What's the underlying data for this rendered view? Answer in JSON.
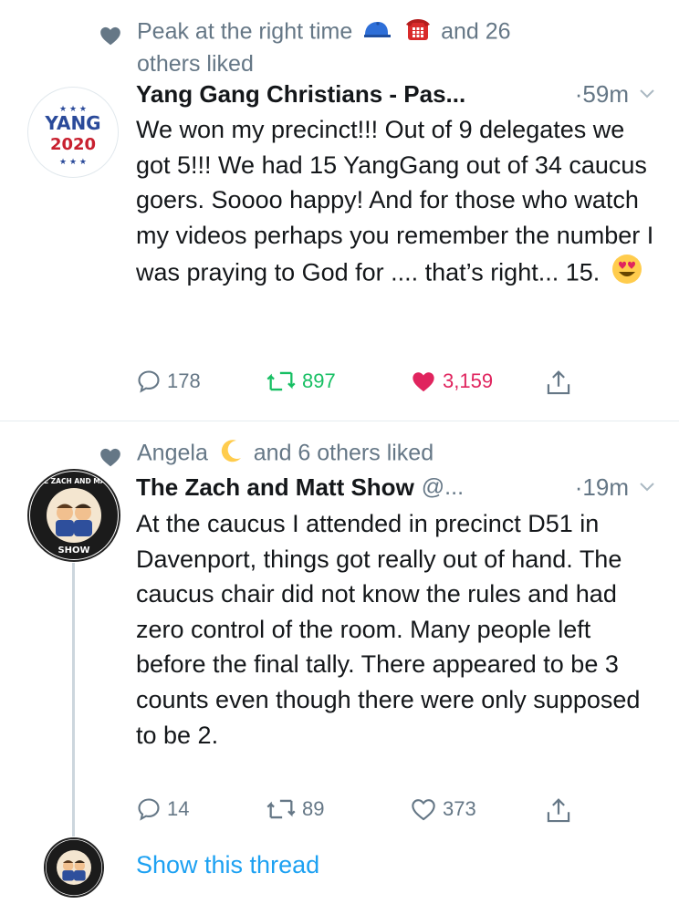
{
  "colors": {
    "accent": "#1da1f2",
    "secondary_text": "#657786",
    "retweet_green": "#17bf63",
    "like_red": "#e0245e",
    "divider": "#e6ecf0"
  },
  "tweets": [
    {
      "liked_by_prefix": "Peak at the right time",
      "liked_by_suffix": "and 26 others liked",
      "liked_emojis": [
        "cap-emoji",
        "telephone-emoji"
      ],
      "avatar": {
        "line1": "YANG",
        "line2": "2020"
      },
      "name": "Yang Gang Christians - Pas...",
      "handle": "",
      "time": "·59m",
      "text": "We won my precinct!!! Out of 9 delegates we got 5!!! We had 15 YangGang out of 34 caucus goers. Soooo happy! And for those who watch my videos perhaps you remember the number I was praying to God for .... that’s right... 15.",
      "text_emoji": "heart-eyes-emoji",
      "replies": "178",
      "retweets": "897",
      "likes": "3,159",
      "retweeted": true,
      "liked": true
    },
    {
      "liked_by_prefix": "Angela",
      "liked_by_suffix": "and 6 others liked",
      "liked_emojis": [
        "crescent-moon-emoji"
      ],
      "avatar": {
        "line1": "THE ZACH AND MATT",
        "line2": "SHOW"
      },
      "name": "The Zach and Matt Show",
      "handle": "@...",
      "time": "·19m",
      "text": "At the caucus I attended in precinct D51 in Davenport, things got really out of hand. The caucus chair did not know the rules and had zero control of the room. Many people left before the final tally. There appeared to be 3 counts even though there were only supposed to be 2.",
      "replies": "14",
      "retweets": "89",
      "likes": "373",
      "retweeted": false,
      "liked": false
    }
  ],
  "show_thread": "Show this thread"
}
